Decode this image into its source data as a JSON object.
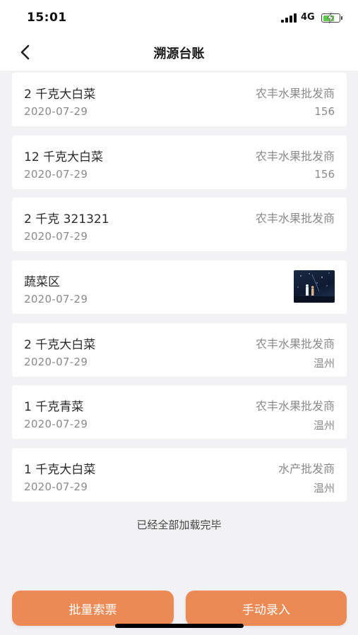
{
  "status_bar": {
    "time": "15:01",
    "network": "4G",
    "battery_color": "#5cc84a"
  },
  "nav": {
    "title": "溯源台账",
    "back_icon": "chevron-left-icon"
  },
  "records": [
    {
      "title": "2 千克大白菜",
      "date": "2020-07-29",
      "vendor": "农丰水果批发商",
      "extra": "156"
    },
    {
      "title": "12 千克大白菜",
      "date": "2020-07-29",
      "vendor": "农丰水果批发商",
      "extra": "156"
    },
    {
      "title": "2 千克 321321",
      "date": "2020-07-29",
      "vendor": "农丰水果批发商",
      "extra": ""
    },
    {
      "title": "蔬菜区",
      "date": "2020-07-29",
      "vendor": "",
      "extra": ""
    },
    {
      "title": "2 千克大白菜",
      "date": "2020-07-29",
      "vendor": "农丰水果批发商",
      "extra": "温州"
    },
    {
      "title": "1 千克青菜",
      "date": "2020-07-29",
      "vendor": "农丰水果批发商",
      "extra": "温州"
    },
    {
      "title": "1 千克大白菜",
      "date": "2020-07-29",
      "vendor": "水产批发商",
      "extra": "温州"
    }
  ],
  "end_note": "已经全部加载完毕",
  "buttons": {
    "batch_invoice": "批量索票",
    "manual_entry": "手动录入"
  },
  "accent_color": "#ec8a55"
}
